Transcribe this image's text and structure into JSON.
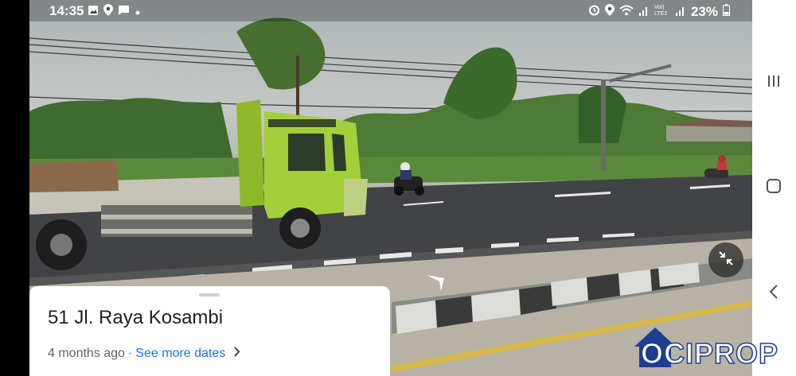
{
  "status_bar": {
    "time": "14:35",
    "battery": "23%",
    "left_icons": [
      "gallery-icon",
      "location-icon",
      "message-icon",
      "dot-icon"
    ],
    "right_icons": [
      "alarm-icon",
      "location-icon",
      "wifi-icon",
      "signal-icon",
      "volte-icon",
      "signal-icon",
      "battery-icon"
    ]
  },
  "card": {
    "address": "51 Jl. Raya Kosambi",
    "age": "4 months ago",
    "separator": "·",
    "see_more": "See more dates"
  },
  "nav_bar": {
    "buttons": [
      "recents-icon",
      "home-icon",
      "back-icon"
    ]
  },
  "watermark": {
    "text": "OCIPROP",
    "brand_color": "#1e3f8f"
  },
  "colors": {
    "link": "#1a73e8",
    "truck": "#9ccc3a"
  }
}
